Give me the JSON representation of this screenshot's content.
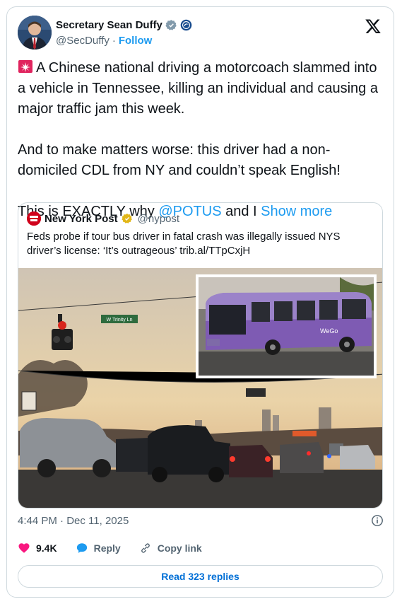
{
  "author": {
    "display_name": "Secretary Sean Duffy",
    "handle": "@SecDuffy",
    "separator": "·",
    "follow_label": "Follow"
  },
  "tweet": {
    "line1": "A Chinese national driving a motorcoach slammed into a vehicle in Tennessee, killing an individual and causing a major traffic jam this week.",
    "line2": "And to make matters worse: this driver had a non-domiciled CDL from NY and couldn’t speak English!",
    "line3_pre": "This is EXACTLY why ",
    "mention": "@POTUS",
    "line3_post": " and I ",
    "show_more": "Show more"
  },
  "quote": {
    "display_name": "New York Post",
    "handle": "@nypost",
    "text": "Feds probe if tour bus driver in fatal crash was illegally issued NYS driver’s license: ‘It’s outrageous’ trib.al/TTpCxjH",
    "street_sign": "W Trinity Ln",
    "bus_brand": "WeGo"
  },
  "timestamp": "4:44 PM · Dec 11, 2025",
  "actions": {
    "likes": "9.4K",
    "reply_label": "Reply",
    "copy_link_label": "Copy link"
  },
  "read_replies_label": "Read 323 replies",
  "colors": {
    "accent": "#1d9bf0",
    "like_red": "#f91880",
    "nypost_red": "#d0021b",
    "text": "#0f1419",
    "muted": "#536471"
  },
  "icons": [
    "verified-badge-icon",
    "dot-gov-badge-icon",
    "x-logo-icon",
    "siren-icon",
    "gold-verified-badge-icon",
    "info-icon",
    "heart-icon",
    "reply-bubble-icon",
    "link-icon"
  ]
}
